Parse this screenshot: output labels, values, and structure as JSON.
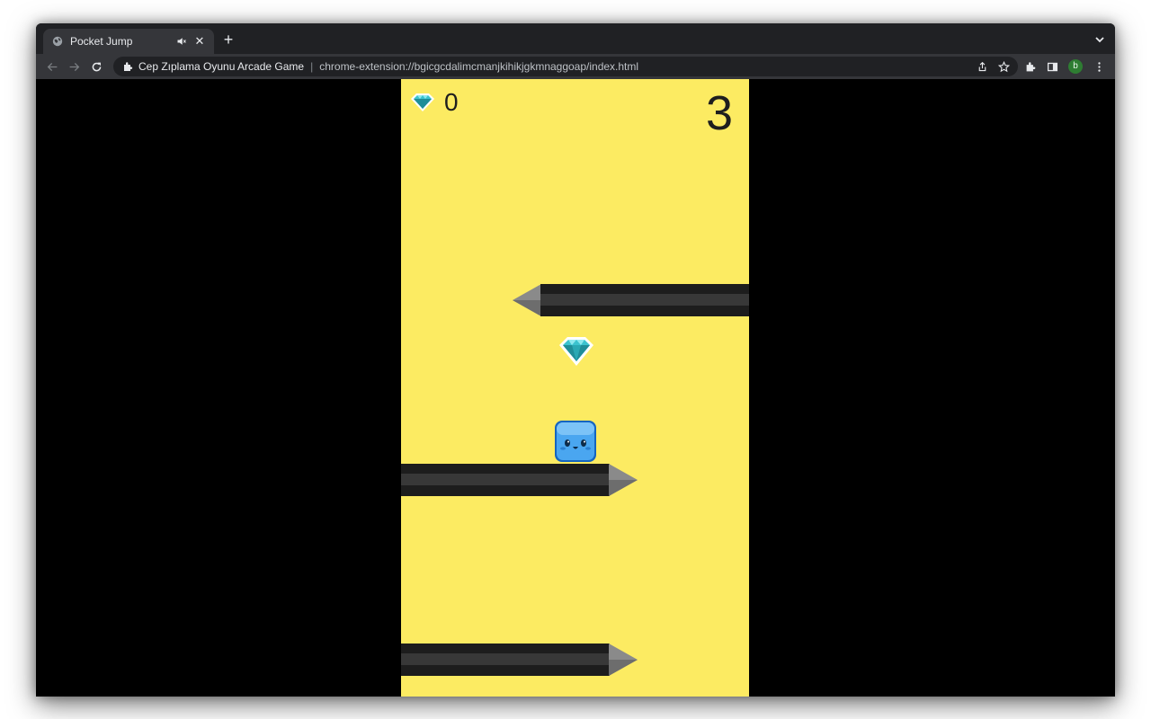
{
  "browser": {
    "tab_title": "Pocket Jump",
    "new_tab": "+",
    "close_glyph": "✕",
    "site_name": "Cep Zıplama Oyunu Arcade Game",
    "separator": "|",
    "url": "chrome-extension://bgicgcdalimcmanjkihikjgkmnaggoap/index.html",
    "profile_initial": "b",
    "icons": [
      "globe-icon",
      "audio-mute-icon",
      "close-icon",
      "chevron-down-icon",
      "back-icon",
      "forward-icon",
      "reload-icon",
      "puzzle-icon",
      "share-icon",
      "star-icon",
      "extensions-icon",
      "side-panel-icon",
      "avatar",
      "menu-icon"
    ]
  },
  "game": {
    "title": "Pocket Jump",
    "gems_collected": "0",
    "score": "3",
    "colors": {
      "background": "#fceb62",
      "pencil_body": "#1d1d1d",
      "pencil_tip": "#8a8a8a",
      "gem": "#3bc3cf",
      "player": "#4aa6f0"
    }
  }
}
